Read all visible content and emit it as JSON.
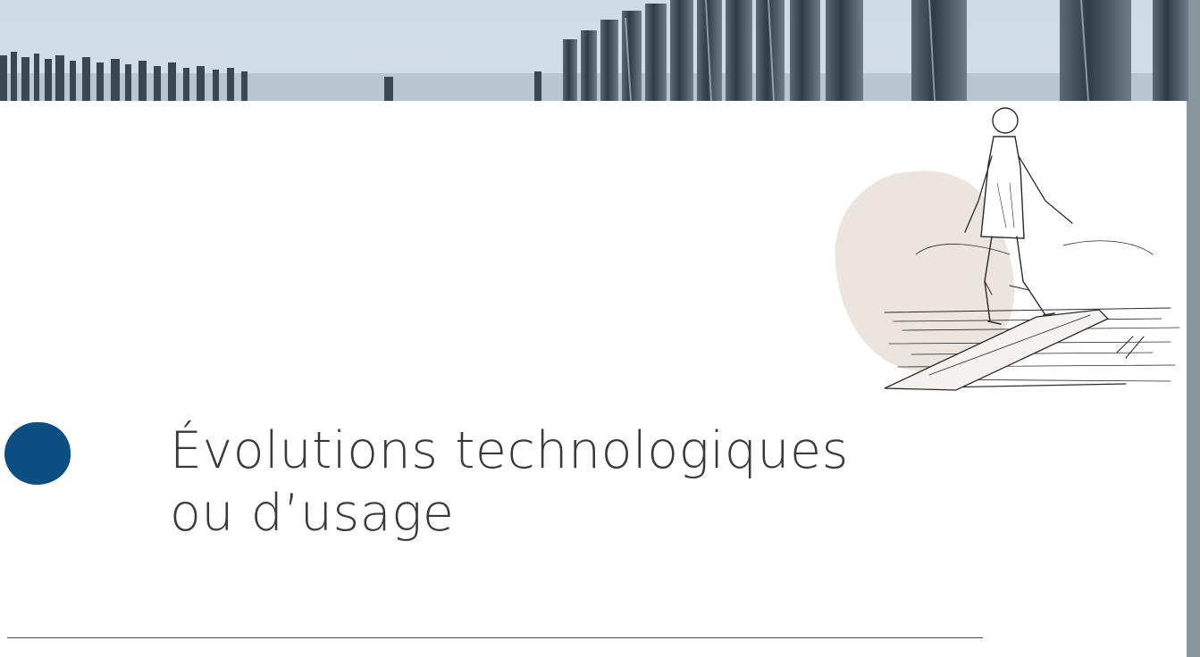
{
  "section": {
    "title_line1": "Évolutions technologiques",
    "title_line2": "ou d’usage"
  },
  "colors": {
    "accent": "#0b4f82",
    "text": "#3a3a3a",
    "sky": "#dfe8ef",
    "sea": "#9fb2c0",
    "illustration_bg": "#ece4de"
  },
  "images": {
    "top_photo": "breakwater-posts-photo",
    "illustration": "person-standing-on-board-drawing"
  }
}
